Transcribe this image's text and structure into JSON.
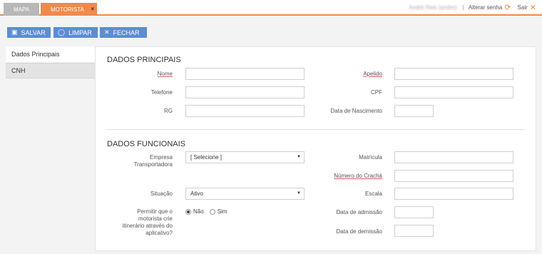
{
  "tabs": [
    {
      "label": "MAPA"
    },
    {
      "label": "MOTORISTA",
      "close": "×"
    }
  ],
  "header": {
    "user_name": "André Reis (andre)",
    "separator": "|",
    "change_password": "Alterar senha",
    "logout": "Sair"
  },
  "toolbar": {
    "save": "SALVAR",
    "clear": "LIMPAR",
    "close": "FECHAR"
  },
  "side_tabs": [
    "Dados Principais",
    "CNH"
  ],
  "dados_principais": {
    "title": "DADOS PRINCIPAIS",
    "nome": "Nome",
    "apelido": "Apelido",
    "telefone": "Telefone",
    "cpf": "CPF",
    "rg": "RG",
    "data_nascimento": "Data de Nascimento"
  },
  "dados_funcionais": {
    "title": "DADOS FUNCIONAIS",
    "empresa_line1": "Empresa",
    "empresa_line2": "Transportadora",
    "empresa_value": "[ Selecione ]",
    "matricula": "Matrícula",
    "numero_cracha": "Número do Crachá",
    "situacao": "Situação",
    "situacao_value": "Ativo",
    "escala": "Escala",
    "permitir_line1": "Permitir que o",
    "permitir_line2": "motorista crie",
    "permitir_line3": "itinerário através do",
    "permitir_line4": "aplicativo?",
    "nao": "Não",
    "sim": "Sim",
    "data_admissao": "Data de admissão",
    "data_demissao": "Data de demissão"
  },
  "colors": {
    "accent": "#f08a4b",
    "button": "#5b8dd4"
  }
}
